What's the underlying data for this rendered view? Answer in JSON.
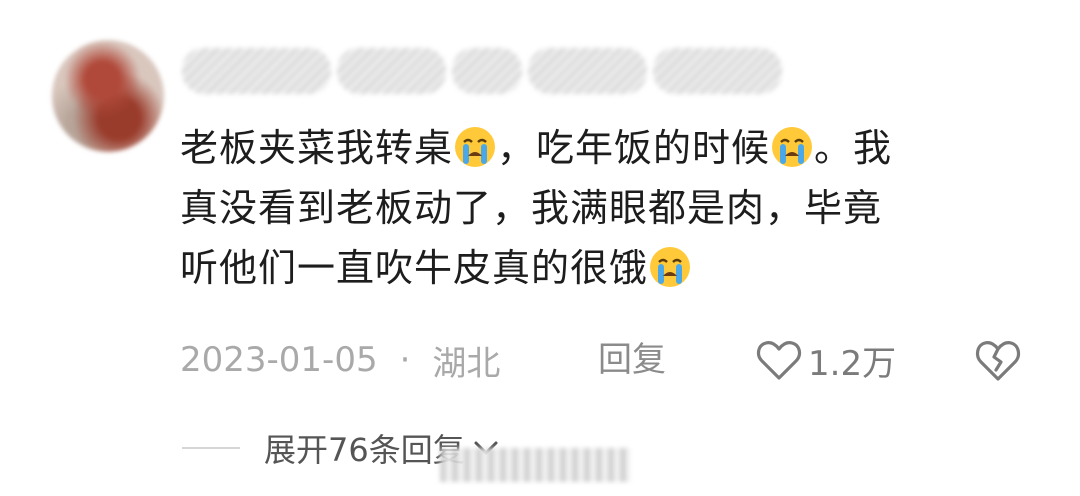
{
  "comment": {
    "username": "",
    "text_line1_a": "老板夹菜我转桌",
    "text_line1_b": "，吃年饭的时候",
    "text_line1_c": "。我",
    "text_line2": "真没看到老板动了，我满眼都是肉，毕竟",
    "text_line3": "听他们一直吹牛皮真的很饿",
    "emoji_icon": "loudly-crying-face-icon",
    "date": "2023-01-05",
    "dot": "·",
    "location": "湖北",
    "reply_label": "回复",
    "like_count": "1.2万",
    "like_icon": "heart-outline-icon",
    "dislike_icon": "broken-heart-icon"
  },
  "replies": {
    "expand_label": "展开76条回复",
    "chevron_icon": "chevron-down-icon"
  },
  "colors": {
    "text": "#1d1d1d",
    "meta": "#a9a9a9",
    "emoji_face": "#ffc93a",
    "tears": "#4aa8e8"
  }
}
